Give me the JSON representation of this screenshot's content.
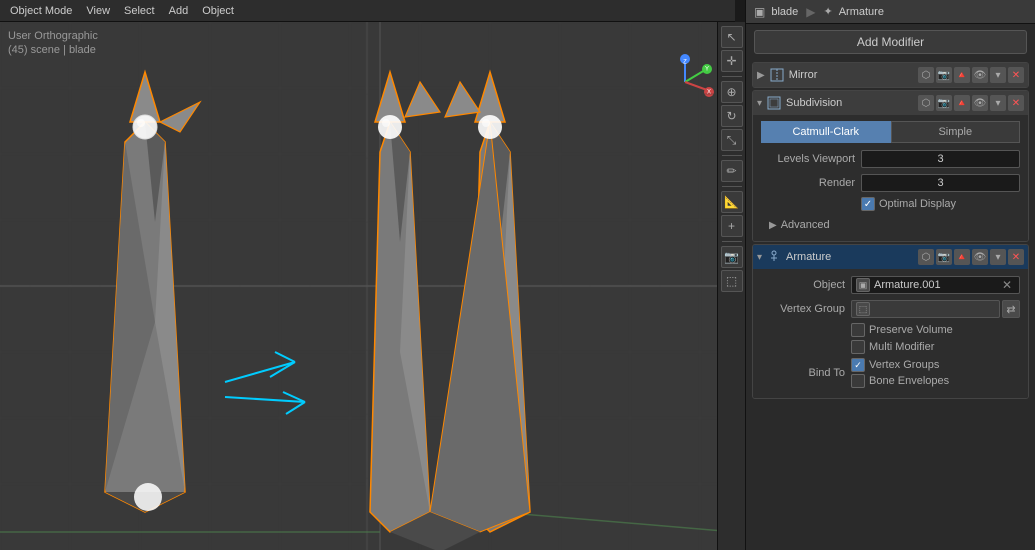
{
  "topbar": {
    "items": [
      "Object Mode",
      "View",
      "Select",
      "Add",
      "Object"
    ]
  },
  "viewport": {
    "label1": "User Orthographic",
    "label2": "(45) scene | blade"
  },
  "panel": {
    "title": "blade",
    "armature_label": "Armature",
    "add_modifier_label": "Add Modifier"
  },
  "modifiers": {
    "mirror": {
      "name": "Mirror",
      "collapsed": true
    },
    "subdivision": {
      "name": "Subdivision",
      "algo_tabs": [
        "Catmull-Clark",
        "Simple"
      ],
      "active_tab": 0,
      "levels_viewport_label": "Levels Viewport",
      "levels_viewport_value": "3",
      "render_label": "Render",
      "render_value": "3",
      "optimal_display_label": "Optimal Display",
      "optimal_display_checked": true,
      "advanced_label": "Advanced"
    },
    "armature": {
      "name": "Armature",
      "object_label": "Object",
      "object_value": "Armature.001",
      "vertex_group_label": "Vertex Group",
      "preserve_volume_label": "Preserve Volume",
      "multi_modifier_label": "Multi Modifier",
      "bind_to_label": "Bind To",
      "vertex_groups_label": "Vertex Groups",
      "vertex_groups_checked": true,
      "bone_envelopes_label": "Bone Envelopes",
      "bone_envelopes_checked": false
    }
  }
}
